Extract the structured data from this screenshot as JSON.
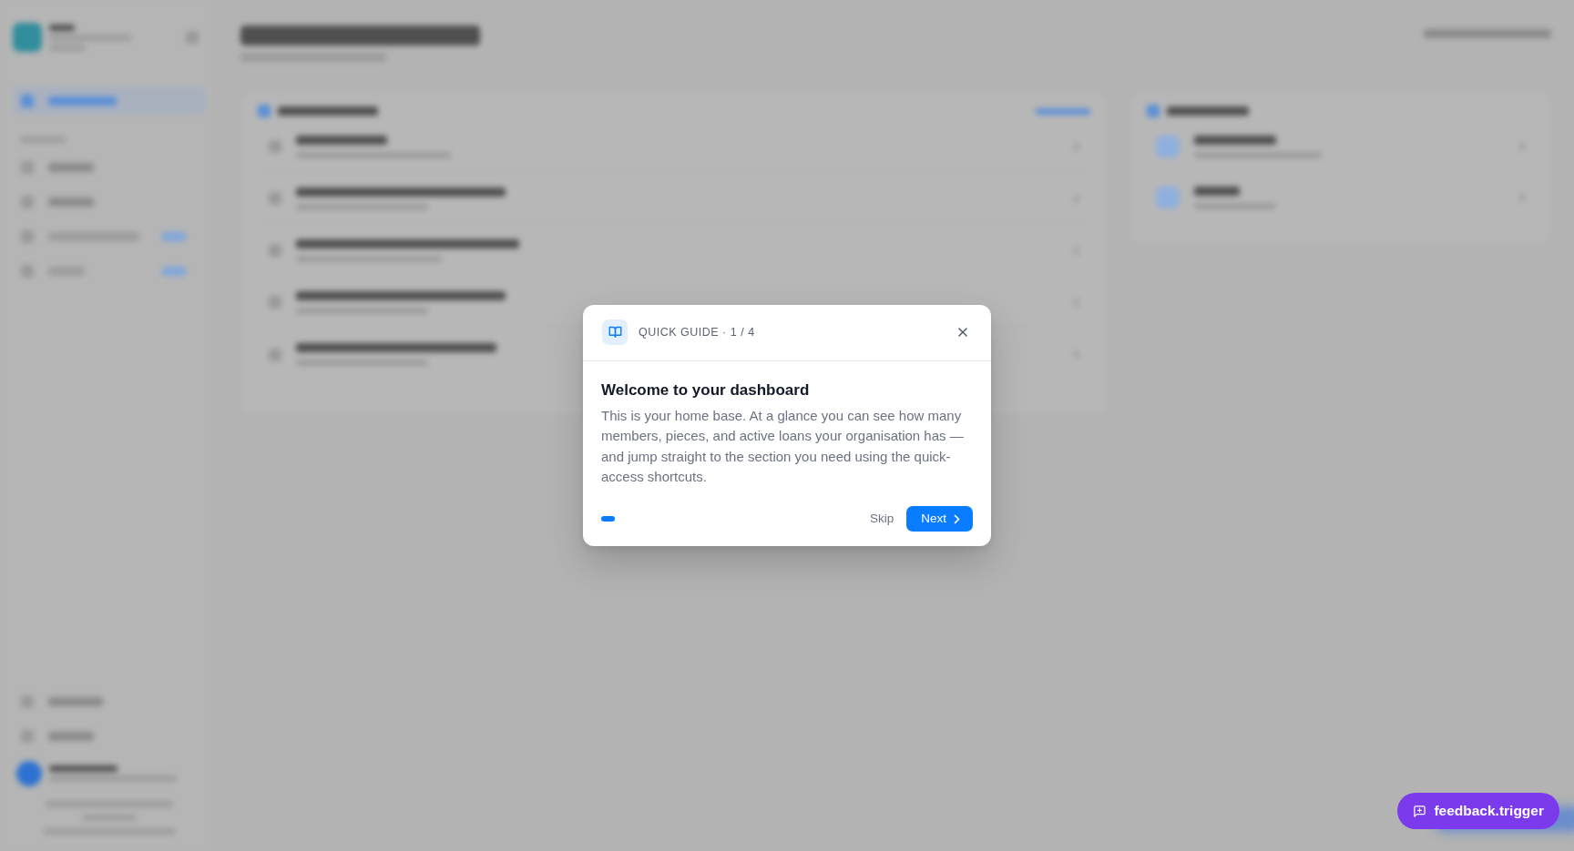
{
  "guide": {
    "title": "QUICK GUIDE · 1 / 4",
    "heading": "Welcome to your dashboard",
    "body": "This is your home base. At a glance you can see how many members, pieces, and active loans your organisation has — and jump straight to the section you need using the quick-access shortcuts.",
    "steps": [
      {
        "selected": true
      }
    ],
    "skip": "Skip",
    "next": "Next"
  },
  "feedback_button": {
    "label": "feedback.trigger"
  }
}
